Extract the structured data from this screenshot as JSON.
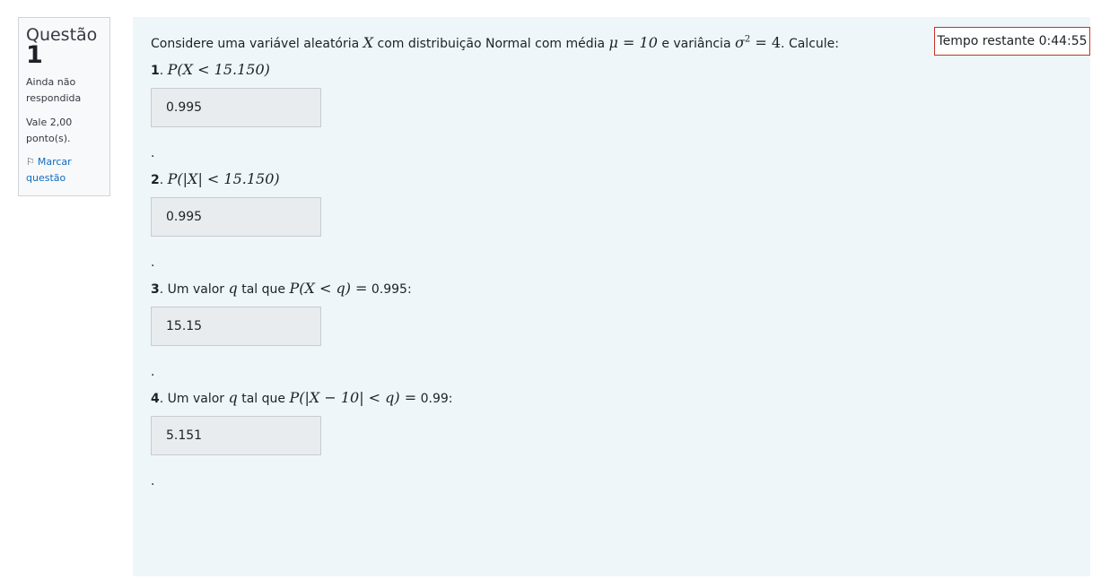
{
  "info": {
    "question_label": "Questão",
    "question_number": "1",
    "state": "Ainda não respondida",
    "grade": "Vale 2,00 ponto(s).",
    "flag_label": "Marcar questão"
  },
  "timer": {
    "label": "Tempo restante 0:44:55"
  },
  "question": {
    "intro_text": "Considere uma variável aleatória",
    "intro_var": "X",
    "intro_text2": "com distribuição Normal com média",
    "intro_mean": "μ = 10",
    "intro_text3": "e variância",
    "intro_var_sym": "σ",
    "intro_var_exp": "2",
    "intro_var_rest": " = 4",
    "intro_text4": ". Calcule:",
    "items": [
      {
        "number": "1",
        "pre": "",
        "math": "P(X < 15.150)",
        "post": "",
        "answer": "0.995"
      },
      {
        "number": "2",
        "pre": "",
        "math": "P(|X| < 15.150)",
        "post": "",
        "answer": "0.995"
      },
      {
        "number": "3",
        "pre": "Um valor",
        "var": "q",
        "mid": "tal que",
        "math": "P(X < q) =",
        "post": "0.995:",
        "answer": "15.15"
      },
      {
        "number": "4",
        "pre": "Um valor",
        "var": "q",
        "mid": "tal que",
        "math": "P(|X − 10| < q) =",
        "post": "0.99:",
        "answer": "5.151"
      }
    ],
    "separator": "."
  },
  "colors": {
    "panel": "#eef6fa",
    "timer_border": "#ca3120",
    "link": "#0f6cbf"
  },
  "icons": {
    "flag": "flag-icon"
  }
}
